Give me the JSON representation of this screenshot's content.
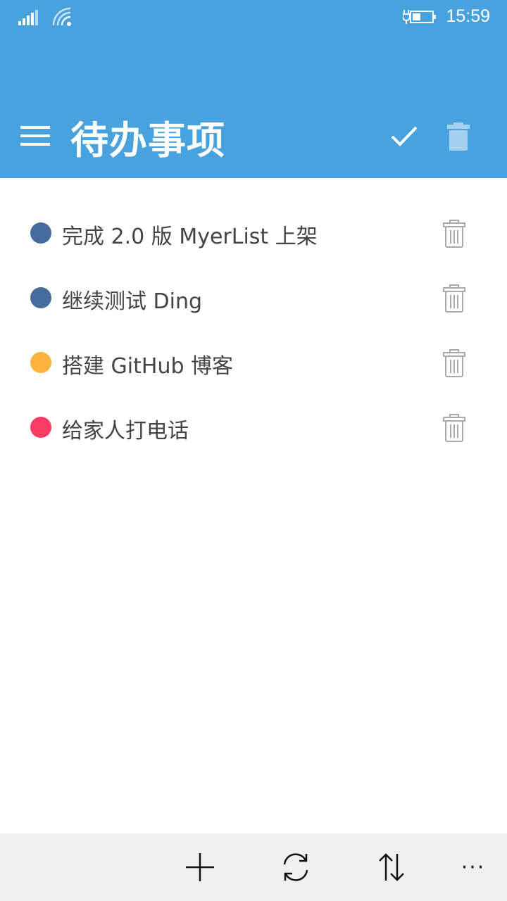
{
  "status_bar": {
    "time": "15:59",
    "signal_icon": "cellular-signal-icon",
    "wifi_icon": "wifi-icon",
    "battery_icon": "battery-charging-icon"
  },
  "header": {
    "title": "待办事项",
    "background_color": "#48a2dd",
    "menu_icon": "hamburger-menu-icon",
    "check_icon": "check-icon",
    "delete_icon": "trash-icon"
  },
  "todos": [
    {
      "text": "完成 2.0 版 MyerList 上架",
      "color": "#456c9c"
    },
    {
      "text": "继续测试 Ding",
      "color": "#456c9c"
    },
    {
      "text": "搭建 GitHub 博客",
      "color": "#ffb33f"
    },
    {
      "text": "给家人打电话",
      "color": "#ff3b63"
    }
  ],
  "app_bar": {
    "add_icon": "plus-icon",
    "sync_icon": "sync-icon",
    "sort_icon": "sort-icon",
    "more_label": "···"
  }
}
